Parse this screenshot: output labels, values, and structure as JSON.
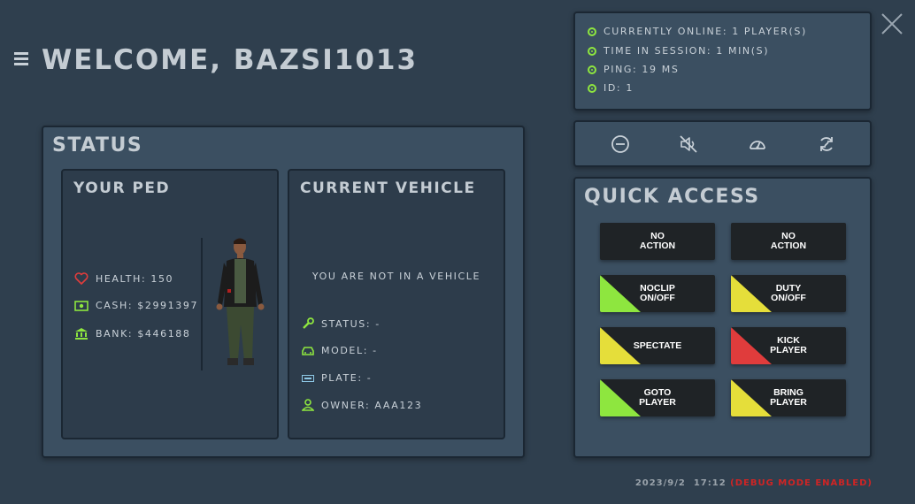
{
  "header": {
    "welcome": "WELCOME, BAZSI1013"
  },
  "session": {
    "items": [
      {
        "label": "Currently online: 1 player(s)"
      },
      {
        "label": "Time in session: 1 min(s)"
      },
      {
        "label": "Ping: 19 ms"
      },
      {
        "label": "ID: 1"
      }
    ]
  },
  "toolbar": {
    "icons": [
      "minus-circle-icon",
      "mute-icon",
      "speedometer-icon",
      "refresh-icon"
    ]
  },
  "status": {
    "title": "Status",
    "ped": {
      "title": "Your Ped",
      "health_label": "Health: 150",
      "cash_label": "Cash: $2991397",
      "bank_label": "Bank: $446188"
    },
    "vehicle": {
      "title": "Current Vehicle",
      "message": "You are not in a vehicle",
      "status_label": "Status: -",
      "model_label": "Model: -",
      "plate_label": "Plate: -",
      "owner_label": "Owner: AAA123"
    }
  },
  "quick_access": {
    "title": "Quick Access",
    "buttons": [
      {
        "label": "NO\nACTION",
        "color": ""
      },
      {
        "label": "NO\nACTION",
        "color": ""
      },
      {
        "label": "NOCLIP\nON/OFF",
        "color": "#8ee63f"
      },
      {
        "label": "DUTY\nON/OFF",
        "color": "#e5de3a"
      },
      {
        "label": "SPECTATE",
        "color": "#e5de3a"
      },
      {
        "label": "KICK\nPLAYER",
        "color": "#e03c3c"
      },
      {
        "label": "GOTO\nPLAYER",
        "color": "#8ee63f"
      },
      {
        "label": "BRING\nPLAYER",
        "color": "#e5de3a"
      }
    ]
  },
  "footer": {
    "datetime": "2023/9/2  17:12",
    "debug": "(DEBUG MODE ENABLED)"
  },
  "colors": {
    "accent_green": "#8ee63f",
    "heart_red": "#e03c3c",
    "debug_red": "#d02424"
  }
}
